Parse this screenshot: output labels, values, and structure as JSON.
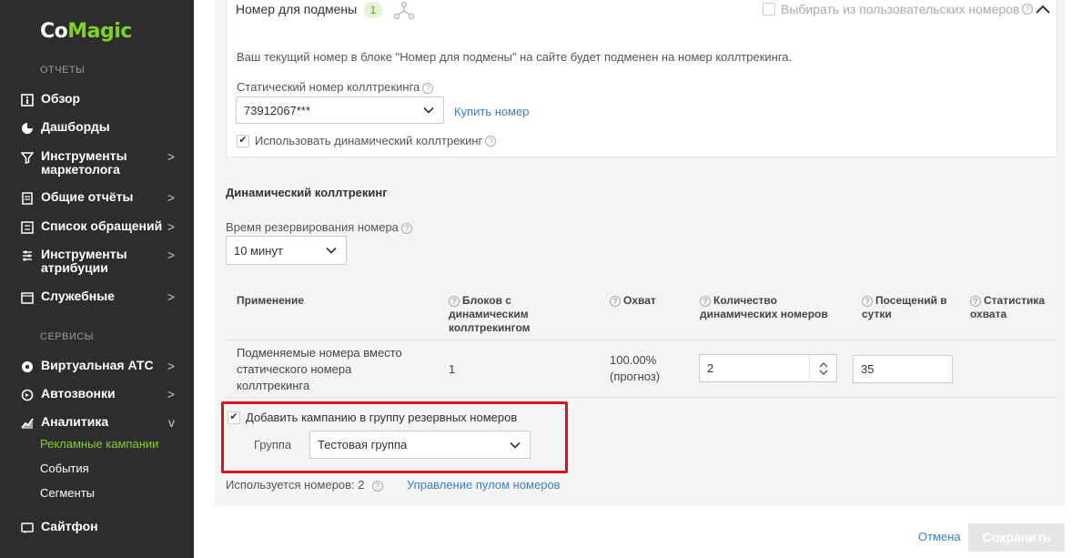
{
  "sidebar": {
    "logo_part1": "Co",
    "logo_part2": "Magic",
    "section_reports": "ОТЧЕТЫ",
    "section_services": "СЕРВИСЫ",
    "reports": [
      {
        "label": "Обзор",
        "icon": "info-box-icon"
      },
      {
        "label": "Дашборды",
        "icon": "pie-chart-icon"
      },
      {
        "label": "Инструменты маркетолога",
        "icon": "funnel-icon",
        "arrow": ">"
      },
      {
        "label": "Общие отчёты",
        "icon": "document-icon",
        "arrow": ">"
      },
      {
        "label": "Список обращений",
        "icon": "list-icon",
        "arrow": ">"
      },
      {
        "label": "Инструменты атрибуции",
        "icon": "sliders-icon",
        "arrow": ">"
      },
      {
        "label": "Служебные",
        "icon": "calendar-icon",
        "arrow": ">"
      }
    ],
    "services": [
      {
        "label": "Виртуальная АТС",
        "icon": "phone-network-icon",
        "arrow": ">"
      },
      {
        "label": "Автозвонки",
        "icon": "auto-call-icon",
        "arrow": ">"
      },
      {
        "label": "Аналитика",
        "icon": "analytics-icon",
        "arrow": "v"
      }
    ],
    "analytics_sub": [
      "Рекламные кампании",
      "События",
      "Сегменты"
    ],
    "sitephone": {
      "label": "Сайтфон",
      "icon": "sitephone-icon"
    }
  },
  "card": {
    "title": "Номер для подмены",
    "badge": "1",
    "pool_checkbox_label": "Выбирать из пользовательских номеров",
    "info_text": "Ваш текущий номер в блоке \"Номер для подмены\" на сайте будет подменен на номер коллтрекинга.",
    "static_label": "Статический номер коллтрекинга",
    "static_value": "73912067***",
    "buy_link": "Купить номер",
    "dynamic_checkbox_label": "Использовать динамический коллтрекинг"
  },
  "dynamic": {
    "title": "Динамический коллтрекинг",
    "reserve_label": "Время резервирования номера",
    "reserve_value": "10 минут"
  },
  "table": {
    "headers": {
      "application": "Применение",
      "blocks": "Блоков с динамическим коллтрекингом",
      "coverage": "Охват",
      "count": "Количество динамических номеров",
      "visits": "Посещений в сутки",
      "stats": "Статистика охвата"
    },
    "row": {
      "application": "Подменяемые номера вместо статического номера коллтрекинга",
      "blocks": "1",
      "coverage": "100.00% (прогноз)",
      "count": "2",
      "visits": "35"
    }
  },
  "reserve_group": {
    "checkbox_label": "Добавить кампанию в группу резервных номеров",
    "group_label": "Группа",
    "group_value": "Тестовая группа"
  },
  "footer": {
    "used_numbers": "Используется номеров: 2",
    "pool_link": "Управление пулом номеров",
    "cancel": "Отмена",
    "save": "Сохранить"
  },
  "colors": {
    "accent_green": "#7ed321",
    "link_blue": "#3b80c7",
    "highlight_red": "#d9141c",
    "sidebar_bg": "#2d2d2d"
  }
}
